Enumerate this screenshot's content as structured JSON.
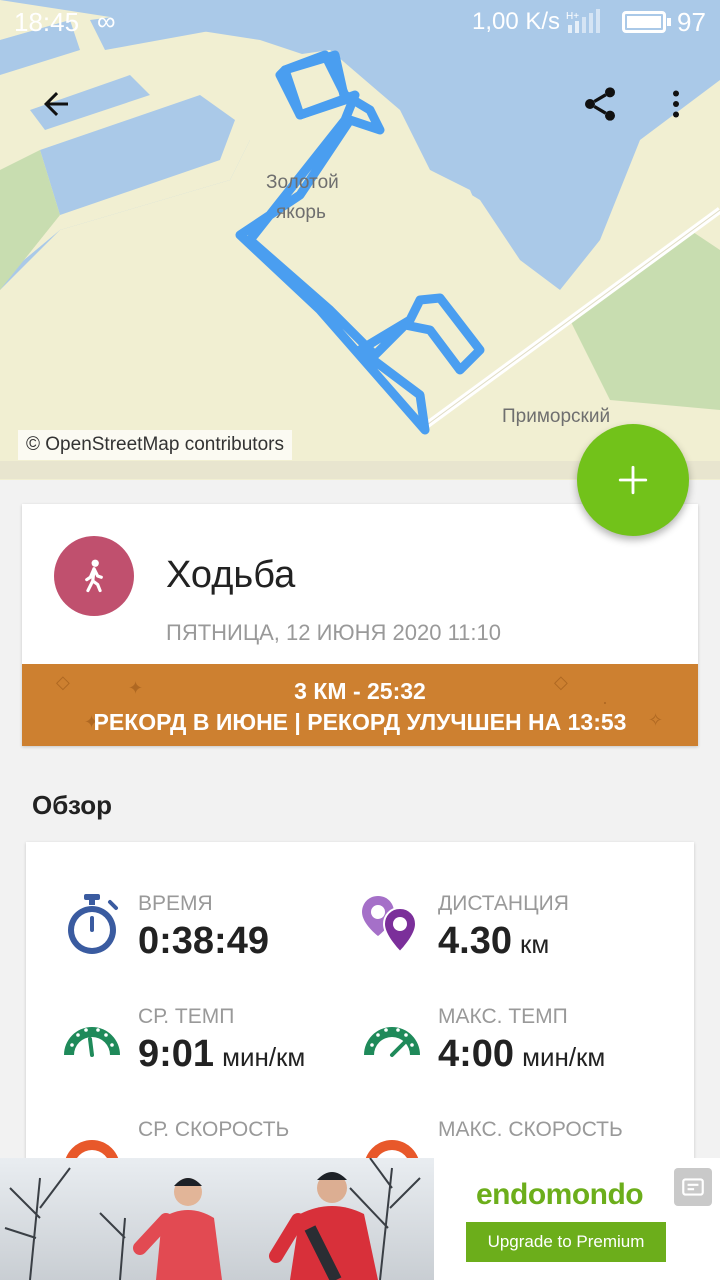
{
  "status_bar": {
    "time": "18:45",
    "infinity_glyph": "∞",
    "speed": "1,00 K/s",
    "network": "H+",
    "battery_pct": "97",
    "battery_level": 0.97
  },
  "map": {
    "labels": [
      "Золотой",
      "якорь",
      "Приморский"
    ],
    "attribution": "© OpenStreetMap contributors",
    "route_color": "#4a9ef0"
  },
  "toolbar": {
    "back_icon": "arrow-back-icon",
    "share_icon": "share-icon",
    "menu_icon": "more-vert-icon"
  },
  "fab": {
    "icon": "plus-icon",
    "color": "#72c21a"
  },
  "workout": {
    "sport": "Ходьба",
    "date": "ПЯТНИЦА, 12 ИЮНЯ 2020 11:10",
    "icon": "walking-icon",
    "icon_color": "#c0506e",
    "record_line1": "3 КМ  -  25:32",
    "record_line2": "РЕКОРД В ИЮНЕ  |  РЕКОРД УЛУЧШЕН НА 13:53",
    "record_color": "#cd8030"
  },
  "overview": {
    "title": "Обзор",
    "stats": [
      {
        "label": "ВРЕМЯ",
        "value": "0:38:49",
        "unit": "",
        "icon": "stopwatch-icon"
      },
      {
        "label": "ДИСТАНЦИЯ",
        "value": "4.30",
        "unit": "км",
        "icon": "location-pins-icon"
      },
      {
        "label": "СР. ТЕМП",
        "value": "9:01",
        "unit": "мин/км",
        "icon": "gauge-icon"
      },
      {
        "label": "МАКС. ТЕМП",
        "value": "4:00",
        "unit": "мин/км",
        "icon": "gauge-icon"
      },
      {
        "label": "СР. СКОРОСТЬ",
        "value": "",
        "unit": "",
        "icon": "speedometer-icon"
      },
      {
        "label": "МАКС. СКОРОСТЬ",
        "value": "",
        "unit": "",
        "icon": "speedometer-icon"
      }
    ]
  },
  "ad": {
    "brand": "endomondo",
    "button": "Upgrade to Premium",
    "brand_color": "#6cae1b"
  }
}
